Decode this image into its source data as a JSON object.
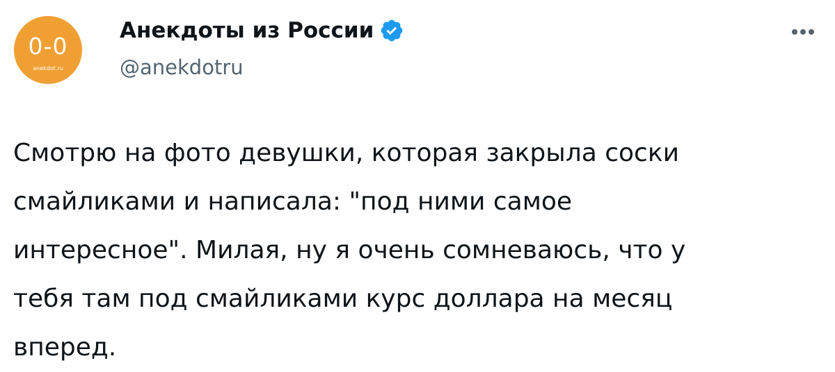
{
  "author": {
    "avatar_logo_text": "0-0",
    "avatar_site_text": "anekdot.ru",
    "name": "Анекдоты из России",
    "handle": "@anekdotru",
    "verified_icon": "verified-badge-icon",
    "more_icon": "more-horizontal-icon"
  },
  "tweet": {
    "lines": [
      "Смотрю на фото девушки, которая закрыла соски",
      "смайликами и написала: \"под ними самое",
      "интересное\". Милая, ну я очень сомневаюсь, что у",
      "тебя там под смайликами курс доллара на месяц",
      "вперед."
    ]
  },
  "colors": {
    "avatar_bg": "#f0a033",
    "verified_blue": "#1d9bf0",
    "text_primary": "#0f1419",
    "text_secondary": "#536471"
  }
}
